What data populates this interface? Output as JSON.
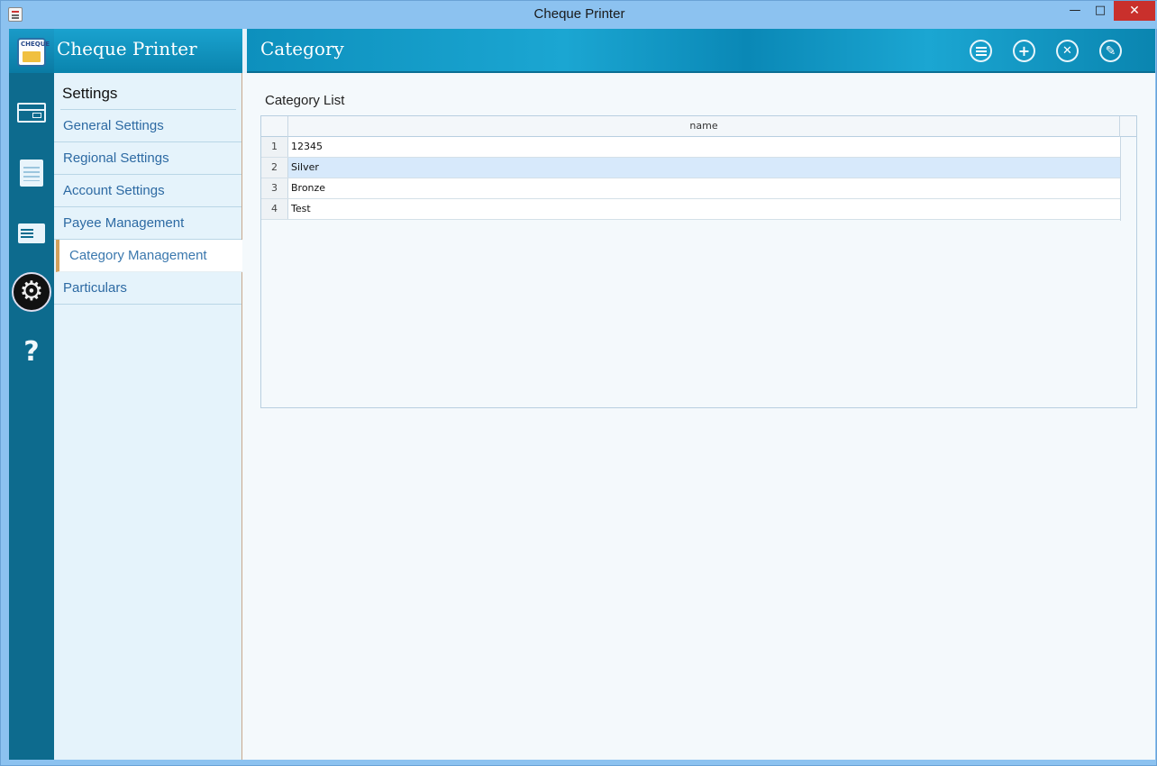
{
  "window": {
    "title": "Cheque Printer",
    "minimize_glyph": "—",
    "maximize_glyph": "□",
    "close_glyph": "✕"
  },
  "app": {
    "name": "Cheque Printer",
    "logo_text": "CHEQUE"
  },
  "rail": {
    "items": [
      {
        "icon": "card-icon"
      },
      {
        "icon": "document-icon"
      },
      {
        "icon": "edit-cheque-icon"
      },
      {
        "icon": "settings-gear-icon",
        "active": true
      },
      {
        "icon": "help-icon",
        "glyph": "?"
      }
    ],
    "gear_glyph": "⚙"
  },
  "header": {
    "page_title": "Category",
    "buttons": [
      {
        "icon": "list-icon"
      },
      {
        "icon": "add-icon",
        "glyph": "+"
      },
      {
        "icon": "delete-icon",
        "glyph": "✕"
      },
      {
        "icon": "edit-icon",
        "glyph": "✎"
      }
    ]
  },
  "menu": {
    "heading": "Settings",
    "items": [
      {
        "label": "General Settings"
      },
      {
        "label": "Regional Settings"
      },
      {
        "label": "Account Settings"
      },
      {
        "label": "Payee Management"
      },
      {
        "label": "Category Management",
        "active": true
      },
      {
        "label": "Particulars"
      }
    ]
  },
  "category_list": {
    "title": "Category List",
    "columns": [
      "name"
    ],
    "rows": [
      {
        "num": "1",
        "name": "12345"
      },
      {
        "num": "2",
        "name": "Silver",
        "selected": true
      },
      {
        "num": "3",
        "name": "Bronze"
      },
      {
        "num": "4",
        "name": "Test"
      }
    ]
  },
  "colors": {
    "accent": "#0d90bd",
    "rail": "#0d6b8e",
    "active_marker": "#d4a15c",
    "close_button": "#c9302c"
  }
}
